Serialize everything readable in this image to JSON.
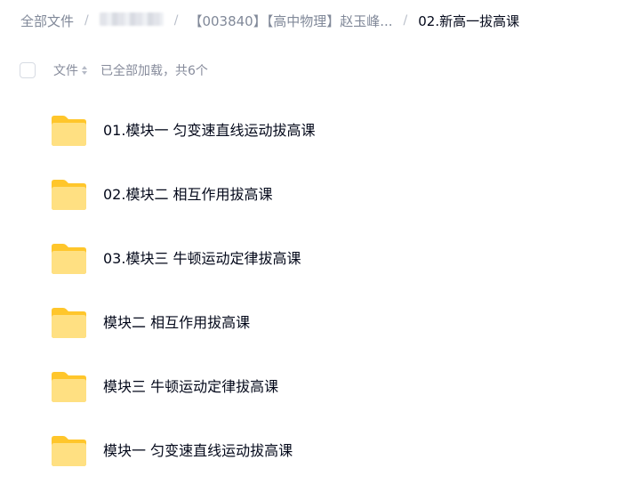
{
  "breadcrumb": {
    "root": "全部文件",
    "separator": "/",
    "folder_1": "【003840】【高中物理】赵玉峰...",
    "current": "02.新高一拔高课"
  },
  "list_header": {
    "column_name": "文件",
    "load_status": "已全部加载，共6个"
  },
  "files": [
    {
      "name": "01.模块一 匀变速直线运动拔高课",
      "icon": "folder-icon"
    },
    {
      "name": "02.模块二 相互作用拔高课",
      "icon": "folder-icon"
    },
    {
      "name": "03.模块三 牛顿运动定律拔高课",
      "icon": "folder-icon"
    },
    {
      "name": "模块二 相互作用拔高课",
      "icon": "folder-icon"
    },
    {
      "name": "模块三 牛顿运动定律拔高课",
      "icon": "folder-icon"
    },
    {
      "name": "模块一 匀变速直线运动拔高课",
      "icon": "folder-icon"
    }
  ],
  "colors": {
    "folder_back": "#ffc62b",
    "folder_front": "#ffe082",
    "text_primary": "#03081a",
    "text_secondary": "#878c9c"
  }
}
